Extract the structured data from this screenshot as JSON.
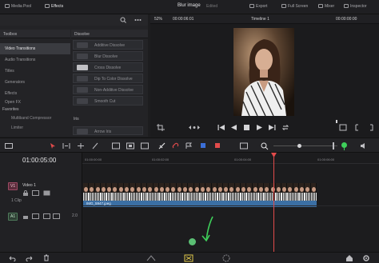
{
  "topbar": {
    "media_pool": "Media Pool",
    "effects": "Effects",
    "project_title": "Blur image",
    "project_state": "Edited",
    "export": "Export",
    "full_screen": "Full Screen",
    "mixer": "Mixer",
    "inspector": "Inspector"
  },
  "effects": {
    "toolbox_header": "Toolbox",
    "dissolve_header": "Dissolve",
    "tree": [
      "Video Transitions",
      "Audio Transitions",
      "Titles",
      "Generators",
      "Effects",
      "Open FX"
    ],
    "dissolve_items": [
      "Additive Dissolve",
      "Blur Dissolve",
      "Cross Dissolve",
      "Dip To Color Dissolve",
      "Non-Additive Dissolve",
      "Smooth Cut"
    ],
    "iris_header": "Iris",
    "iris_item": "Arrow Iris",
    "favorites_header": "Favorites",
    "favorites": [
      "Multiband Compressor",
      "Limiter"
    ]
  },
  "viewer": {
    "zoom": "52%",
    "timecode": "00:00:06:01",
    "timeline_name": "Timeline 1",
    "right_timecode": "00:00:00:00"
  },
  "timeline": {
    "current_timecode": "01:00:05:00",
    "video_track": {
      "badge": "V1",
      "name": "Video 1",
      "count": "1 Clip"
    },
    "audio_track": {
      "badge": "A1",
      "level": "2.0"
    },
    "ruler_labels": [
      "01:00:00:00",
      "01:00:02:00",
      "01:00:04:00",
      "01:00:06:00",
      "01:00:08:00"
    ],
    "clip_name": "IMG_5947.jpeg"
  },
  "colors": {
    "accent_red": "#e24b4b",
    "accent_green": "#3ecf5a",
    "clip_blue": "#3b6fa4"
  }
}
